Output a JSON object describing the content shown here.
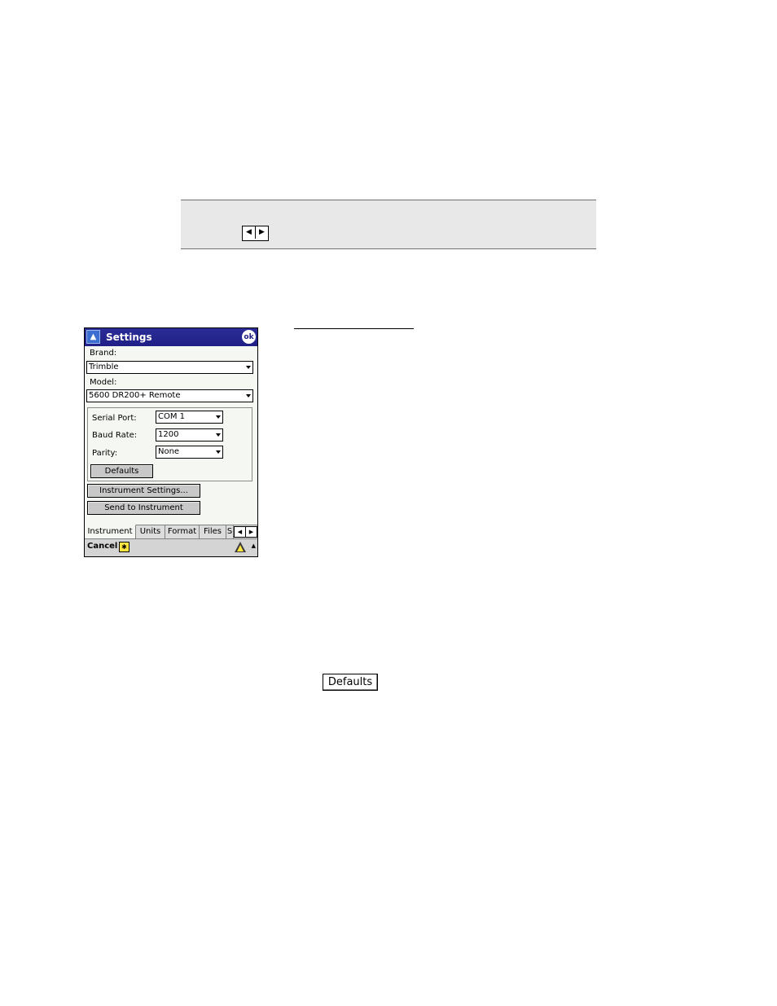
{
  "note": {
    "scroll_left": "◀",
    "scroll_right": "▶"
  },
  "pda": {
    "title": "Settings",
    "ok_label": "ok",
    "brand_label": "Brand:",
    "brand_value": "Trimble",
    "model_label": "Model:",
    "model_value": "5600 DR200+ Remote",
    "serial_port_label": "Serial Port:",
    "serial_port_value": "COM 1",
    "baud_rate_label": "Baud Rate:",
    "baud_rate_value": "1200",
    "parity_label": "Parity:",
    "parity_value": "None",
    "defaults_button": "Defaults",
    "instrument_settings_button": "Instrument Settings...",
    "send_to_instrument_button": "Send to Instrument",
    "tabs": [
      "Instrument",
      "Units",
      "Format",
      "Files",
      "S"
    ],
    "cancel_label": "Cancel",
    "sip_glyph": "✱"
  },
  "standalone_defaults_button": "Defaults"
}
